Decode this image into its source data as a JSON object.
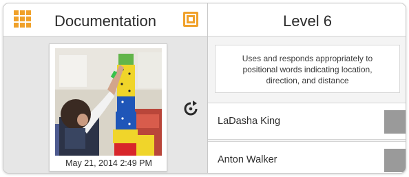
{
  "documentation_panel": {
    "title": "Documentation",
    "photo": {
      "caption": "May  21, 2014 2:49 PM"
    },
    "icons": {
      "menu": "grid-menu-icon",
      "share": "share-icon",
      "rotate": "rotate-icon"
    }
  },
  "level_panel": {
    "title": "Level 6",
    "standard_text": "Uses and responds appropriately to positional words indicating location, direction, and distance",
    "students": [
      {
        "name": "LaDasha King"
      },
      {
        "name": "Anton Walker"
      }
    ]
  },
  "colors": {
    "accent": "#f0a12a",
    "check_box": "#9a9a9a",
    "pane_gray": "#e6e6e6"
  }
}
